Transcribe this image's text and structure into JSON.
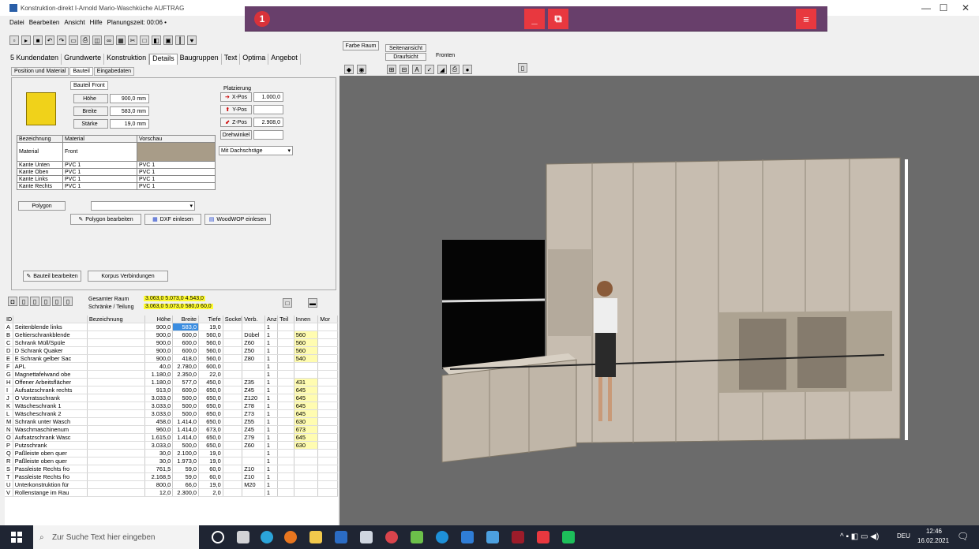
{
  "window": {
    "title": "Konstruktion-direkt I-Arnold Mario-Waschküche AUFTRAG"
  },
  "menu": [
    "Datei",
    "Bearbeiten",
    "Ansicht",
    "Hilfe",
    "Planungszeit: 00:06 •"
  ],
  "overlay": {
    "badge": "1",
    "btn_minimize": "_",
    "btn_restore": "⧉",
    "btn_menu": "≡"
  },
  "tabs_main": [
    "5 Kundendaten",
    "Grundwerte",
    "Konstruktion",
    "Details",
    "Baugruppen",
    "Text",
    "Optima",
    "Angebot"
  ],
  "tabs_main_active": "Details",
  "tabs_sub": [
    "Position und Material",
    "Bauteil",
    "Eingabedaten"
  ],
  "tabs_sub_active": "Bauteil",
  "bauteil": {
    "group": "Bauteil Front",
    "hoehe_label": "Höhe",
    "hoehe": "900,0 mm",
    "breite_label": "Breite",
    "breite": "583,0 mm",
    "staerke_label": "Stärke",
    "staerke": "19,0 mm"
  },
  "platzierung": {
    "group": "Platzierung",
    "xpos_label": "X-Pos",
    "xpos": "1.000,0",
    "ypos_label": "Y-Pos",
    "ypos": "",
    "zpos_label": "Z-Pos",
    "zpos": "2.908,0",
    "drehwinkel_label": "Drehwinkel",
    "drehwinkel": "",
    "dachschraege": "Mit Dachschräge"
  },
  "material_table": {
    "headers": [
      "Bezeichnung",
      "Material",
      "Vorschau"
    ],
    "rows": [
      [
        "Material",
        "Front",
        ""
      ],
      [
        "Kante Unten",
        "PVC 1",
        "PVC 1"
      ],
      [
        "Kante Oben",
        "PVC 1",
        "PVC 1"
      ],
      [
        "Kante Links",
        "PVC 1",
        "PVC 1"
      ],
      [
        "Kante Rechts",
        "PVC 1",
        "PVC 1"
      ]
    ]
  },
  "polygon": {
    "label": "Polygon",
    "value": "",
    "bearbeiten": "Polygon bearbeiten",
    "dxf": "DXF einlesen",
    "woodwop": "WoodWOP einlesen"
  },
  "panel_buttons": {
    "bauteil_bearbeiten": "Bauteil bearbeiten",
    "korpus": "Korpus Verbindungen"
  },
  "view_toolbar": {
    "farbe_raum": "Farbe Raum",
    "seitenansicht": "Seitenansicht",
    "draufsicht": "Draufsicht",
    "fronten": "Fronten"
  },
  "grid_summary": {
    "raum_label": "Gesamter Raum",
    "raum_values": "3.063,0 5.073,0 4.543,0",
    "teilung_label": "Schränke / Teilung",
    "teilung_values": "3.063,0 5.073,0 580,0 60,0"
  },
  "grid": {
    "headers": [
      "ID",
      "",
      "Bezeichnung",
      "Höhe",
      "Breite",
      "Tiefe",
      "Sockel",
      "Verb.",
      "Anz",
      "Teil",
      "Innen",
      "Mor"
    ],
    "rows": [
      [
        "A",
        "Seitenblende links",
        "",
        "900,0",
        "583,0",
        "19,0",
        "",
        "",
        "1",
        "",
        "",
        ""
      ],
      [
        "B",
        "Geltierschrankblende",
        "",
        "900,0",
        "600,0",
        "560,0",
        "",
        "Dübel",
        "1",
        "",
        "560",
        ""
      ],
      [
        "C",
        "Schrank Müll/Spüle",
        "",
        "900,0",
        "600,0",
        "560,0",
        "",
        "Z60",
        "1",
        "",
        "560",
        ""
      ],
      [
        "D",
        "D Schrank Quaker",
        "",
        "900,0",
        "600,0",
        "560,0",
        "",
        "Z50",
        "1",
        "",
        "560",
        ""
      ],
      [
        "E",
        "E Schrank gelber Sac",
        "",
        "900,0",
        "418,0",
        "560,0",
        "",
        "Z80",
        "1",
        "",
        "540",
        ""
      ],
      [
        "F",
        "APL",
        "",
        "40,0",
        "2.780,0",
        "600,0",
        "",
        "",
        "1",
        "",
        "",
        ""
      ],
      [
        "G",
        "Magnettafelwand obe",
        "",
        "1.180,0",
        "2.350,0",
        "22,0",
        "",
        "",
        "1",
        "",
        "",
        ""
      ],
      [
        "H",
        "Offener Arbeitsflächer",
        "",
        "1.180,0",
        "577,0",
        "450,0",
        "",
        "Z35",
        "1",
        "",
        "431",
        ""
      ],
      [
        "I",
        "Aufsatzschrank rechts",
        "",
        "913,0",
        "600,0",
        "650,0",
        "",
        "Z45",
        "1",
        "",
        "645",
        ""
      ],
      [
        "J",
        "O Vorratsschrank",
        "",
        "3.033,0",
        "500,0",
        "650,0",
        "",
        "Z120",
        "1",
        "",
        "645",
        ""
      ],
      [
        "K",
        "Wäscheschrank 1",
        "",
        "3.033,0",
        "500,0",
        "650,0",
        "",
        "Z78",
        "1",
        "",
        "645",
        ""
      ],
      [
        "L",
        "Wäscheschrank 2",
        "",
        "3.033,0",
        "500,0",
        "650,0",
        "",
        "Z73",
        "1",
        "",
        "645",
        ""
      ],
      [
        "M",
        "Schrank unter Wasch",
        "",
        "458,0",
        "1.414,0",
        "650,0",
        "",
        "Z55",
        "1",
        "",
        "630",
        ""
      ],
      [
        "N",
        "Waschmaschinenum",
        "",
        "960,0",
        "1.414,0",
        "673,0",
        "",
        "Z45",
        "1",
        "",
        "673",
        ""
      ],
      [
        "O",
        "Aufsatzschrank Wasc",
        "",
        "1.615,0",
        "1.414,0",
        "650,0",
        "",
        "Z79",
        "1",
        "",
        "645",
        ""
      ],
      [
        "P",
        "Putzschrank",
        "",
        "3.033,0",
        "500,0",
        "650,0",
        "",
        "Z60",
        "1",
        "",
        "630",
        ""
      ],
      [
        "Q",
        "Paßleiste oben quer",
        "",
        "30,0",
        "2.100,0",
        "19,0",
        "",
        "",
        "1",
        "",
        "",
        ""
      ],
      [
        "R",
        "Paßleiste oben quer",
        "",
        "30,0",
        "1.973,0",
        "19,0",
        "",
        "",
        "1",
        "",
        "",
        ""
      ],
      [
        "S",
        "Passleiste Rechts fro",
        "",
        "761,5",
        "59,0",
        "60,0",
        "",
        "Z10",
        "1",
        "",
        "",
        ""
      ],
      [
        "T",
        "Passleiste Rechts fro",
        "",
        "2.168,5",
        "59,0",
        "60,0",
        "",
        "Z10",
        "1",
        "",
        "",
        ""
      ],
      [
        "U",
        "Unterkonstruktion für",
        "",
        "800,0",
        "66,0",
        "19,0",
        "",
        "M20",
        "1",
        "",
        "",
        ""
      ],
      [
        "V",
        "Rollenstange im Rau",
        "",
        "12,0",
        "2.300,0",
        "2,0",
        "",
        "",
        "1",
        "",
        "",
        ""
      ]
    ]
  },
  "taskbar": {
    "search": "Zur Suche Text hier eingeben",
    "tray_lang": "DEU",
    "time": "12:46",
    "date": "16.02.2021"
  }
}
